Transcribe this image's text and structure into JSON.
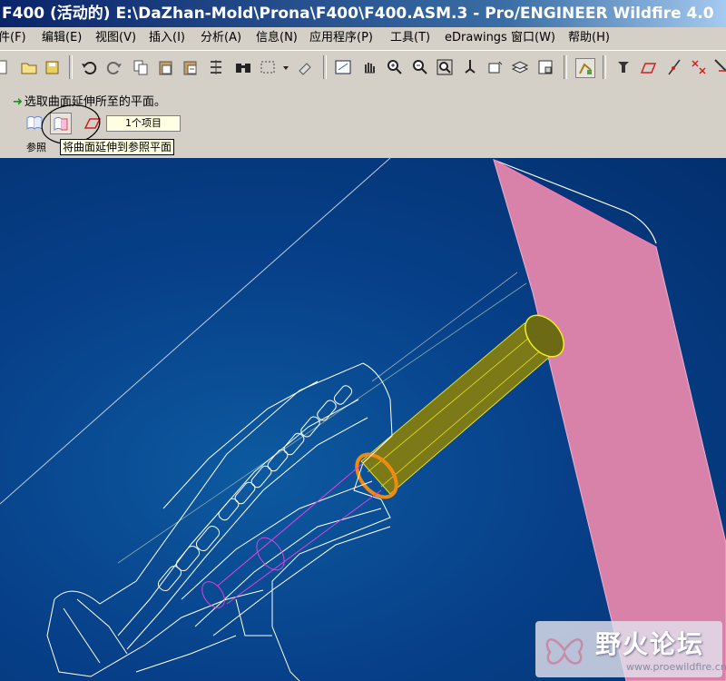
{
  "window": {
    "title": "F400 (活动的) E:\\DaZhan-Mold\\Prona\\F400\\F400.ASM.3 - Pro/ENGINEER Wildfire 4.0"
  },
  "menu": [
    "件(F)",
    "编辑(E)",
    "视图(V)",
    "插入(I)",
    "分析(A)",
    "信息(N)",
    "应用程序(P)",
    "工具(T)",
    "eDrawings",
    "窗口(W)",
    "帮助(H)"
  ],
  "toolbar_icons": [
    "new-file-icon",
    "open-folder-icon",
    "save-icon",
    "undo-icon",
    "redo-icon",
    "copy-icon",
    "paste-icon",
    "paste-special-icon",
    "regenerate-icon",
    "find-icon",
    "select-box-icon",
    "dropdown-icon",
    "eraser-icon",
    "repaint-icon",
    "spin-hand-icon",
    "zoom-in-icon",
    "zoom-out-icon",
    "refit-icon",
    "reorient-icon",
    "saved-views-icon",
    "layers-icon",
    "model-tree-icon",
    "datum-display-icon",
    "datum-plane-icon",
    "datum-axis-icon",
    "datum-point-icon",
    "coordinate-system-icon"
  ],
  "dashboard": {
    "prompt": "选取曲面延伸所至的平面。",
    "collector_value": "1个项目",
    "reference_label": "参照",
    "tooltip": "将曲面延伸到参照平面"
  },
  "watermark": {
    "title": "野火论坛",
    "url": "www.proewildfire.cn"
  },
  "colors": {
    "viewport_bg": "#07418a",
    "surface_pink": "#d882aa",
    "cylinder_olive": "#7c7a18",
    "selection_orange": "#f08a10",
    "highlight_yellow": "#f0f020",
    "wire_white": "#ffffff",
    "magenta_edge": "#e040e0"
  }
}
